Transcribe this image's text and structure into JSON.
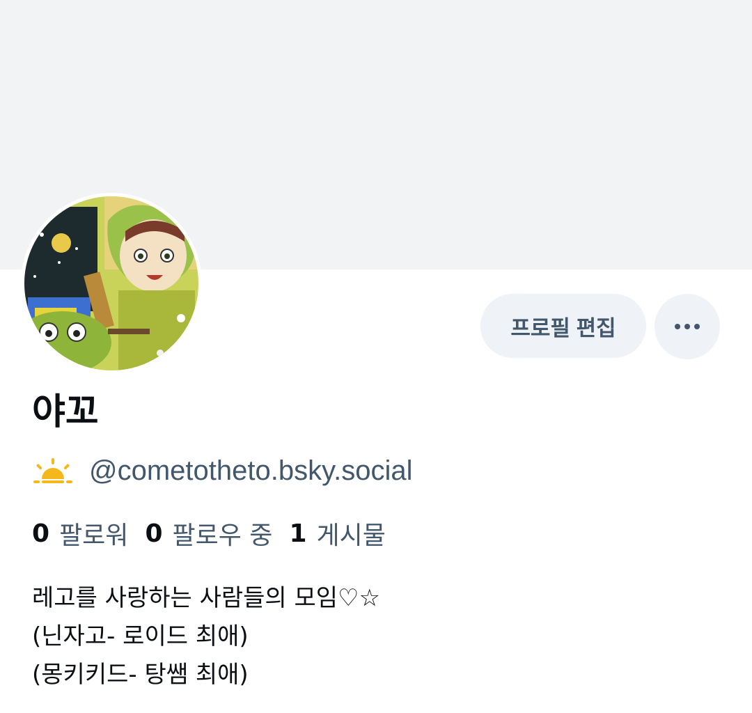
{
  "profile": {
    "display_name": "야꼬",
    "handle": "@cometotheto.bsky.social",
    "handle_icon": "sunrise-icon"
  },
  "actions": {
    "edit_profile_label": "프로필 편집",
    "more_icon": "ellipsis-icon"
  },
  "stats": {
    "followers_count": "0",
    "followers_label": "팔로워",
    "following_count": "0",
    "following_label": "팔로우 중",
    "posts_count": "1",
    "posts_label": "게시물"
  },
  "bio": {
    "line1": "레고를 사랑하는 사람들의 모임♡☆",
    "line2": "(닌자고- 로이드 최애)",
    "line3": "(몽키키드- 탕쌤 최애)"
  },
  "colors": {
    "banner": "#f1f3f5",
    "button_bg": "#eff2f6",
    "secondary_text": "#42576c",
    "primary_text": "#0b0f14",
    "sun": "#f5b81c"
  }
}
